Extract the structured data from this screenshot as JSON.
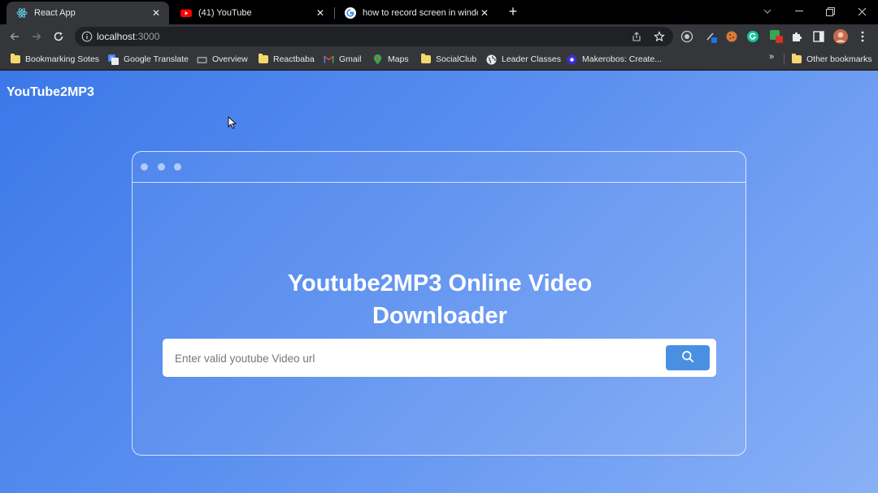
{
  "tabs": [
    {
      "title": "React App",
      "icon": "react-icon",
      "active": true
    },
    {
      "title": "(41) YouTube",
      "icon": "youtube-icon",
      "active": false
    },
    {
      "title": "how to record screen in windows",
      "icon": "google-icon",
      "active": false
    }
  ],
  "address_bar": {
    "host": "localhost",
    "port": ":3000"
  },
  "bookmarks": [
    {
      "label": "Bookmarking Sotes",
      "icon": "folder-icon"
    },
    {
      "label": "Google Translate",
      "icon": "google-translate-icon"
    },
    {
      "label": "Overview",
      "icon": "overview-icon"
    },
    {
      "label": "Reactbaba",
      "icon": "folder-icon"
    },
    {
      "label": "Gmail",
      "icon": "gmail-icon"
    },
    {
      "label": "Maps",
      "icon": "maps-icon"
    },
    {
      "label": "SocialClub",
      "icon": "folder-icon"
    },
    {
      "label": "Leader Classes",
      "icon": "globe-icon"
    },
    {
      "label": "Makerobos: Create...",
      "icon": "makerobos-icon"
    }
  ],
  "bookmarks_overflow": "»",
  "other_bookmarks": "Other bookmarks",
  "page": {
    "brand": "YouTube2MP3",
    "hero_line1": "Youtube2MP3 Online Video",
    "hero_line2": "Downloader",
    "search_placeholder": "Enter valid youtube Video url"
  },
  "colors": {
    "page_gradient_start": "#3b78e8",
    "page_gradient_end": "#89b0f6",
    "search_button": "#4a90e2",
    "chrome_frame": "#35363a"
  }
}
